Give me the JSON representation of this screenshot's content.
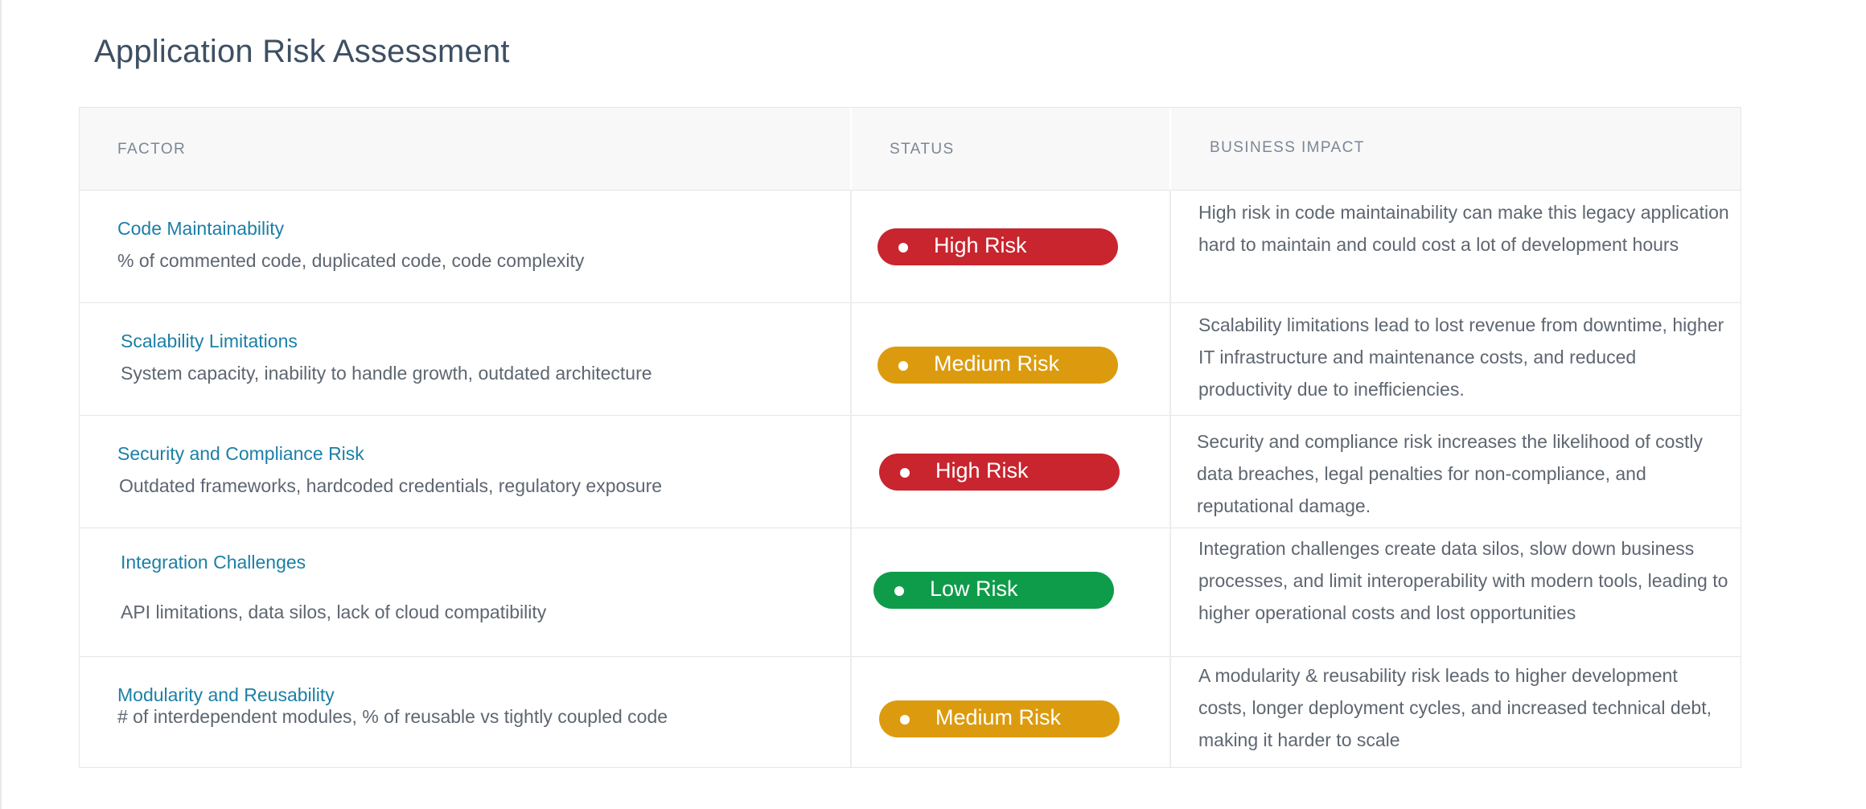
{
  "page": {
    "title": "Application Risk Assessment"
  },
  "table": {
    "headers": {
      "factor": "FACTOR",
      "status": "STATUS",
      "impact": "BUSINESS IMPACT"
    },
    "status_colors": {
      "High Risk": "#c8252f",
      "Medium Risk": "#dc9b0e",
      "Low Risk": "#0f9c4a"
    },
    "rows": [
      {
        "factor_title": "Code Maintainability",
        "factor_desc": "% of commented code, duplicated code, code complexity",
        "status": "High Risk",
        "impact": "High risk in code maintainability can make this legacy application hard to maintain and could cost a lot of development hours"
      },
      {
        "factor_title": "Scalability Limitations",
        "factor_desc": "System capacity, inability to handle growth, outdated architecture",
        "status": "Medium Risk",
        "impact": "Scalability limitations lead to lost revenue from downtime, higher IT infrastructure and maintenance costs, and reduced productivity due to inefficiencies."
      },
      {
        "factor_title": "Security and Compliance Risk",
        "factor_desc": "Outdated frameworks, hardcoded credentials, regulatory exposure",
        "status": "High Risk",
        "impact": "Security and compliance risk increases the likelihood of costly data breaches, legal penalties for non-compliance, and reputational damage."
      },
      {
        "factor_title": "Integration Challenges",
        "factor_desc": "API limitations, data silos, lack of cloud compatibility",
        "status": "Low Risk",
        "impact": "Integration challenges create data silos, slow down business processes, and limit interoperability with modern tools, leading to higher operational costs and lost opportunities"
      },
      {
        "factor_title": "Modularity and Reusability",
        "factor_desc": "# of interdependent modules, % of reusable vs tightly coupled code",
        "status": "Medium Risk",
        "impact": "A modularity & reusability risk leads to higher development costs, longer deployment cycles, and increased technical debt, making it harder to scale"
      }
    ]
  }
}
